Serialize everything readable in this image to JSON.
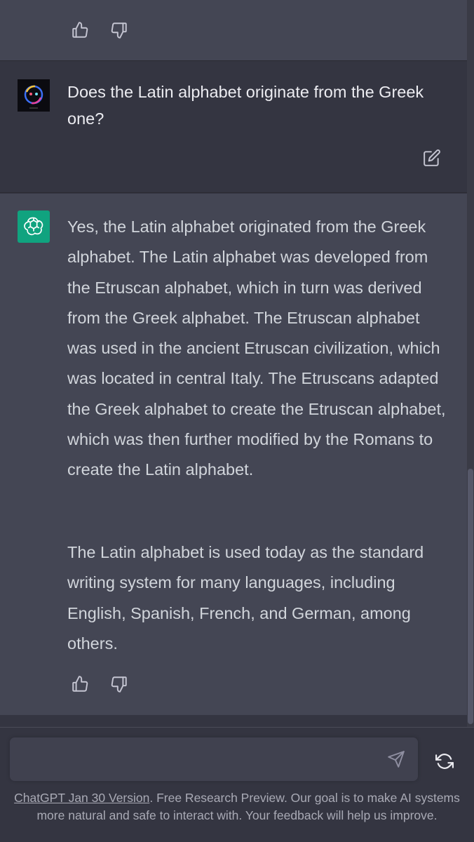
{
  "conversation": {
    "user_message": "Does the Latin alphabet originate from the Greek one?",
    "assistant_paragraphs": [
      "Yes, the Latin alphabet originated from the Greek alphabet. The Latin alphabet was developed from the Etruscan alphabet, which in turn was derived from the Greek alphabet. The Etruscan alphabet was used in the ancient Etruscan civilization, which was located in central Italy. The Etruscans adapted the Greek alphabet to create the Etruscan alphabet, which was then further modified by the Romans to create the Latin alphabet.",
      "The Latin alphabet is used today as the standard writing system for many languages, including English, Spanish, French, and German, among others."
    ]
  },
  "composer": {
    "value": "",
    "placeholder": ""
  },
  "footer": {
    "version_link": "ChatGPT Jan 30 Version",
    "disclaimer": ". Free Research Preview. Our goal is to make AI systems more natural and safe to interact with. Your feedback will help us improve."
  },
  "icons": {
    "thumbs_up": "thumbs-up-icon",
    "thumbs_down": "thumbs-down-icon",
    "edit": "edit-icon",
    "send": "send-icon",
    "regenerate": "regenerate-icon",
    "openai_logo": "openai-logo-icon"
  },
  "colors": {
    "background": "#343541",
    "assistant_background": "#444654",
    "bot_avatar": "#10a37f",
    "input_background": "#40414f",
    "text": "#ececf1"
  }
}
